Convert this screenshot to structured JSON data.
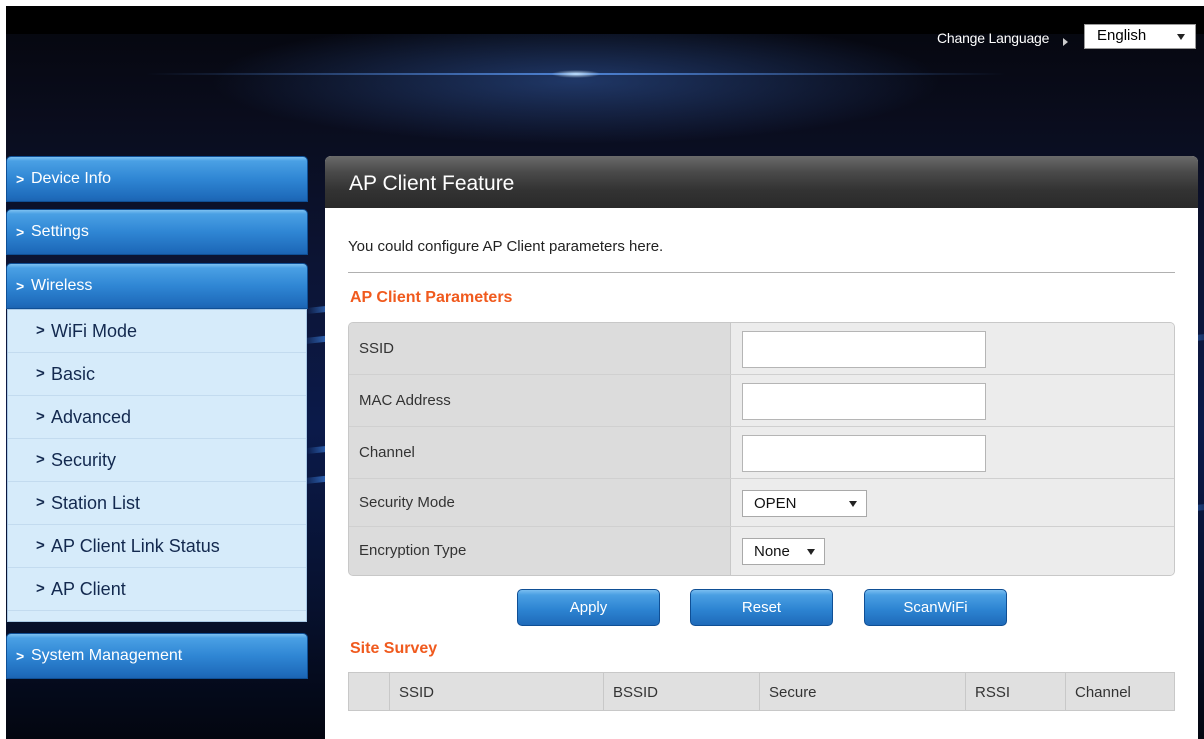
{
  "header": {
    "change_language_label": "Change Language",
    "language_selected": "English"
  },
  "sidebar": {
    "groups": [
      {
        "label": "Device Info"
      },
      {
        "label": "Settings"
      },
      {
        "label": "Wireless"
      },
      {
        "label": "System Management"
      }
    ],
    "wireless_items": [
      {
        "label": "WiFi Mode"
      },
      {
        "label": "Basic"
      },
      {
        "label": "Advanced"
      },
      {
        "label": "Security"
      },
      {
        "label": "Station List"
      },
      {
        "label": "AP Client Link Status"
      },
      {
        "label": "AP Client"
      }
    ]
  },
  "main": {
    "title": "AP Client Feature",
    "intro": "You could configure AP Client parameters here.",
    "params_title": "AP Client Parameters",
    "params": {
      "ssid_label": "SSID",
      "ssid_value": "",
      "mac_label": "MAC Address",
      "mac_value": "",
      "channel_label": "Channel",
      "channel_value": "",
      "security_mode_label": "Security Mode",
      "security_mode_value": "OPEN",
      "encryption_label": "Encryption Type",
      "encryption_value": "None"
    },
    "buttons": {
      "apply": "Apply",
      "reset": "Reset",
      "scan": "ScanWiFi"
    },
    "survey_title": "Site Survey",
    "survey_columns": [
      "",
      "SSID",
      "BSSID",
      "Secure",
      "RSSI",
      "Channel"
    ]
  },
  "colors": {
    "accent_orange": "#f05a1e",
    "button_blue": "#2c83d1",
    "panel_header": "#333333",
    "submenu_bg": "#d6ebfa"
  }
}
